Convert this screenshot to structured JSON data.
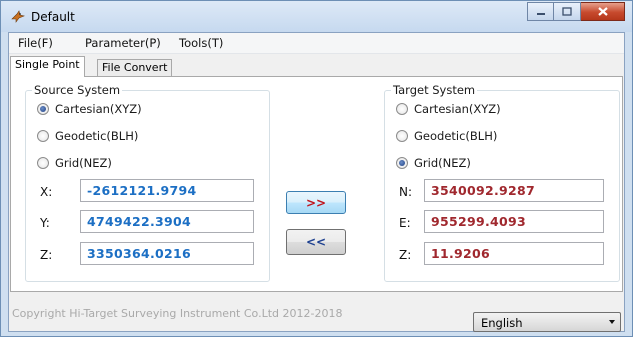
{
  "window": {
    "title": "Default",
    "icon": "app-bird-icon",
    "controls": [
      "minimize-icon",
      "maximize-icon",
      "close-icon"
    ]
  },
  "menu": {
    "items": [
      "File(F)",
      "Parameter(P)",
      "Tools(T)"
    ]
  },
  "tabs": [
    {
      "label": "Single Point",
      "active": true
    },
    {
      "label": "File Convert",
      "active": false
    }
  ],
  "source": {
    "title": "Source System",
    "options": [
      {
        "label": "Cartesian(XYZ)",
        "selected": true
      },
      {
        "label": "Geodetic(BLH)",
        "selected": false
      },
      {
        "label": "Grid(NEZ)",
        "selected": false
      }
    ],
    "fields": [
      {
        "label": "X:",
        "value": "-2612121.9794"
      },
      {
        "label": "Y:",
        "value": "4749422.3904"
      },
      {
        "label": "Z:",
        "value": "3350364.0216"
      }
    ]
  },
  "target": {
    "title": "Target System",
    "options": [
      {
        "label": "Cartesian(XYZ)",
        "selected": false
      },
      {
        "label": "Geodetic(BLH)",
        "selected": false
      },
      {
        "label": "Grid(NEZ)",
        "selected": true
      }
    ],
    "fields": [
      {
        "label": "N:",
        "value": "3540092.9287"
      },
      {
        "label": "E:",
        "value": "955299.4093"
      },
      {
        "label": "Z:",
        "value": "11.9206"
      }
    ]
  },
  "buttons": {
    "forward": ">>",
    "backward": "<<"
  },
  "status": {
    "copyright": "Copyright Hi-Target Surveying Instrument Co.Ltd 2012-2018",
    "language": "English"
  },
  "colors": {
    "source_value": "#1c6fc4",
    "target_value": "#a0282e",
    "forward_arrow": "#c0141c",
    "backward_arrow": "#1c3f8f",
    "close_button": "#c74a2e"
  }
}
